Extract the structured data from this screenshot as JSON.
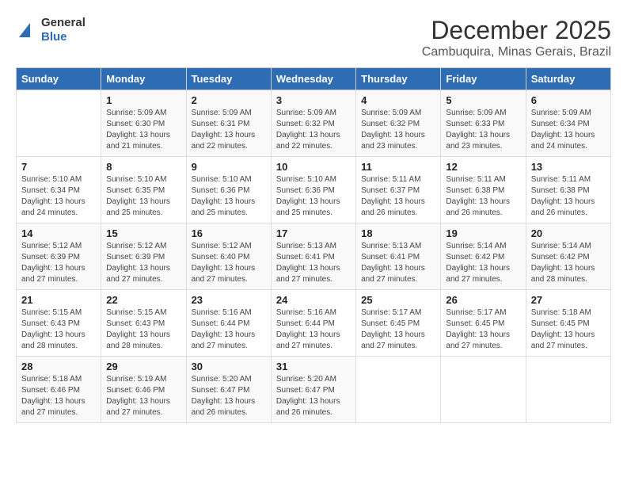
{
  "header": {
    "logo_general": "General",
    "logo_blue": "Blue",
    "title": "December 2025",
    "location": "Cambuquira, Minas Gerais, Brazil"
  },
  "days_of_week": [
    "Sunday",
    "Monday",
    "Tuesday",
    "Wednesday",
    "Thursday",
    "Friday",
    "Saturday"
  ],
  "weeks": [
    [
      {
        "day": "",
        "info": ""
      },
      {
        "day": "1",
        "info": "Sunrise: 5:09 AM\nSunset: 6:30 PM\nDaylight: 13 hours\nand 21 minutes."
      },
      {
        "day": "2",
        "info": "Sunrise: 5:09 AM\nSunset: 6:31 PM\nDaylight: 13 hours\nand 22 minutes."
      },
      {
        "day": "3",
        "info": "Sunrise: 5:09 AM\nSunset: 6:32 PM\nDaylight: 13 hours\nand 22 minutes."
      },
      {
        "day": "4",
        "info": "Sunrise: 5:09 AM\nSunset: 6:32 PM\nDaylight: 13 hours\nand 23 minutes."
      },
      {
        "day": "5",
        "info": "Sunrise: 5:09 AM\nSunset: 6:33 PM\nDaylight: 13 hours\nand 23 minutes."
      },
      {
        "day": "6",
        "info": "Sunrise: 5:09 AM\nSunset: 6:34 PM\nDaylight: 13 hours\nand 24 minutes."
      }
    ],
    [
      {
        "day": "7",
        "info": "Sunrise: 5:10 AM\nSunset: 6:34 PM\nDaylight: 13 hours\nand 24 minutes."
      },
      {
        "day": "8",
        "info": "Sunrise: 5:10 AM\nSunset: 6:35 PM\nDaylight: 13 hours\nand 25 minutes."
      },
      {
        "day": "9",
        "info": "Sunrise: 5:10 AM\nSunset: 6:36 PM\nDaylight: 13 hours\nand 25 minutes."
      },
      {
        "day": "10",
        "info": "Sunrise: 5:10 AM\nSunset: 6:36 PM\nDaylight: 13 hours\nand 25 minutes."
      },
      {
        "day": "11",
        "info": "Sunrise: 5:11 AM\nSunset: 6:37 PM\nDaylight: 13 hours\nand 26 minutes."
      },
      {
        "day": "12",
        "info": "Sunrise: 5:11 AM\nSunset: 6:38 PM\nDaylight: 13 hours\nand 26 minutes."
      },
      {
        "day": "13",
        "info": "Sunrise: 5:11 AM\nSunset: 6:38 PM\nDaylight: 13 hours\nand 26 minutes."
      }
    ],
    [
      {
        "day": "14",
        "info": "Sunrise: 5:12 AM\nSunset: 6:39 PM\nDaylight: 13 hours\nand 27 minutes."
      },
      {
        "day": "15",
        "info": "Sunrise: 5:12 AM\nSunset: 6:39 PM\nDaylight: 13 hours\nand 27 minutes."
      },
      {
        "day": "16",
        "info": "Sunrise: 5:12 AM\nSunset: 6:40 PM\nDaylight: 13 hours\nand 27 minutes."
      },
      {
        "day": "17",
        "info": "Sunrise: 5:13 AM\nSunset: 6:41 PM\nDaylight: 13 hours\nand 27 minutes."
      },
      {
        "day": "18",
        "info": "Sunrise: 5:13 AM\nSunset: 6:41 PM\nDaylight: 13 hours\nand 27 minutes."
      },
      {
        "day": "19",
        "info": "Sunrise: 5:14 AM\nSunset: 6:42 PM\nDaylight: 13 hours\nand 27 minutes."
      },
      {
        "day": "20",
        "info": "Sunrise: 5:14 AM\nSunset: 6:42 PM\nDaylight: 13 hours\nand 28 minutes."
      }
    ],
    [
      {
        "day": "21",
        "info": "Sunrise: 5:15 AM\nSunset: 6:43 PM\nDaylight: 13 hours\nand 28 minutes."
      },
      {
        "day": "22",
        "info": "Sunrise: 5:15 AM\nSunset: 6:43 PM\nDaylight: 13 hours\nand 28 minutes."
      },
      {
        "day": "23",
        "info": "Sunrise: 5:16 AM\nSunset: 6:44 PM\nDaylight: 13 hours\nand 27 minutes."
      },
      {
        "day": "24",
        "info": "Sunrise: 5:16 AM\nSunset: 6:44 PM\nDaylight: 13 hours\nand 27 minutes."
      },
      {
        "day": "25",
        "info": "Sunrise: 5:17 AM\nSunset: 6:45 PM\nDaylight: 13 hours\nand 27 minutes."
      },
      {
        "day": "26",
        "info": "Sunrise: 5:17 AM\nSunset: 6:45 PM\nDaylight: 13 hours\nand 27 minutes."
      },
      {
        "day": "27",
        "info": "Sunrise: 5:18 AM\nSunset: 6:45 PM\nDaylight: 13 hours\nand 27 minutes."
      }
    ],
    [
      {
        "day": "28",
        "info": "Sunrise: 5:18 AM\nSunset: 6:46 PM\nDaylight: 13 hours\nand 27 minutes."
      },
      {
        "day": "29",
        "info": "Sunrise: 5:19 AM\nSunset: 6:46 PM\nDaylight: 13 hours\nand 27 minutes."
      },
      {
        "day": "30",
        "info": "Sunrise: 5:20 AM\nSunset: 6:47 PM\nDaylight: 13 hours\nand 26 minutes."
      },
      {
        "day": "31",
        "info": "Sunrise: 5:20 AM\nSunset: 6:47 PM\nDaylight: 13 hours\nand 26 minutes."
      },
      {
        "day": "",
        "info": ""
      },
      {
        "day": "",
        "info": ""
      },
      {
        "day": "",
        "info": ""
      }
    ]
  ]
}
